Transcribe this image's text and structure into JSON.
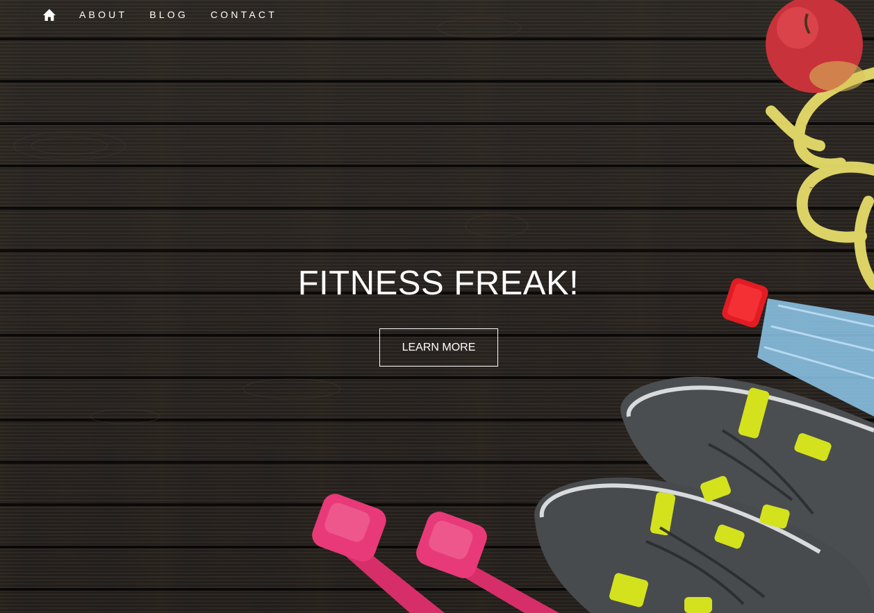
{
  "nav": {
    "home_icon": "home-icon",
    "items": [
      {
        "label": "ABOUT"
      },
      {
        "label": "BLOG"
      },
      {
        "label": "CONTACT"
      }
    ]
  },
  "hero": {
    "title": "FITNESS FREAK!",
    "cta_label": "LEARN MORE"
  },
  "colors": {
    "background": "#26221f",
    "text": "#ffffff",
    "dumbbell": "#e83a78",
    "bottle_cap": "#e31b23",
    "shoe_accent": "#d4e21e",
    "tape": "#e6dc6a",
    "apple": "#c8323a"
  }
}
